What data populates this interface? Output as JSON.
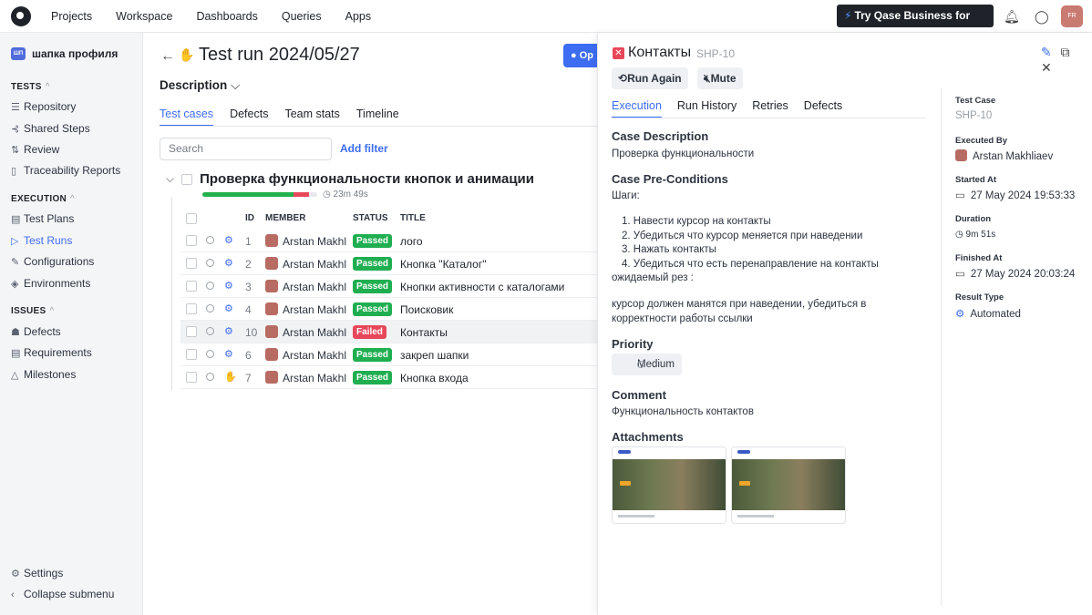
{
  "topnav": {
    "items": [
      "Projects",
      "Workspace",
      "Dashboards",
      "Queries",
      "Apps"
    ],
    "cta": "Try Qase Business for free!",
    "avatar": "FR"
  },
  "sidebar": {
    "project_badge": "ШП",
    "project": "шапка профиля",
    "tests_title": "TESTS",
    "tests": [
      "Repository",
      "Shared Steps",
      "Review",
      "Traceability Reports"
    ],
    "execution_title": "EXECUTION",
    "execution": [
      "Test Plans",
      "Test Runs",
      "Configurations",
      "Environments"
    ],
    "issues_title": "ISSUES",
    "issues": [
      "Defects",
      "Requirements",
      "Milestones"
    ],
    "settings": "Settings",
    "collapse": "Collapse submenu"
  },
  "main": {
    "title": "Test run 2024/05/27",
    "open_btn": "Op",
    "description": "Description",
    "tabs": [
      "Test cases",
      "Defects",
      "Team stats",
      "Timeline"
    ],
    "search_placeholder": "Search",
    "add_filter": "Add filter",
    "suite_title": "Проверка функциональности кнопок и анимации",
    "suite_progress": {
      "passed": 6,
      "failed": 1,
      "total": 7
    },
    "suite_duration": "23m 49s",
    "columns": [
      "ID",
      "MEMBER",
      "STATUS",
      "TITLE"
    ],
    "rows": [
      {
        "id": "1",
        "member": "Arstan Makhl",
        "status": "Passed",
        "title": "лого",
        "type": "automated"
      },
      {
        "id": "2",
        "member": "Arstan Makhl",
        "status": "Passed",
        "title": "Кнопка \"Каталог\"",
        "type": "automated"
      },
      {
        "id": "3",
        "member": "Arstan Makhl",
        "status": "Passed",
        "title": "Кнопки активности с каталогами",
        "type": "automated"
      },
      {
        "id": "4",
        "member": "Arstan Makhl",
        "status": "Passed",
        "title": "Поисковик",
        "type": "automated"
      },
      {
        "id": "10",
        "member": "Arstan Makhl",
        "status": "Failed",
        "title": "Контакты",
        "type": "automated"
      },
      {
        "id": "6",
        "member": "Arstan Makhl",
        "status": "Passed",
        "title": "закреп шапки",
        "type": "automated"
      },
      {
        "id": "7",
        "member": "Arstan Makhl",
        "status": "Passed",
        "title": "Кнопка входа",
        "type": "manual"
      }
    ]
  },
  "panel": {
    "title": "Контакты",
    "code": "SHP-10",
    "run_again": "Run Again",
    "mute": "Mute",
    "tabs": [
      "Execution",
      "Run History",
      "Retries",
      "Defects"
    ],
    "case_description_h": "Case Description",
    "case_description": "Проверка функциональности",
    "preconditions_h": "Case Pre-Conditions",
    "steps_label": "Шаги:",
    "steps": [
      "1. Навести курсор на контакты",
      "2. Убедиться что курсор меняется при наведении",
      "3. Нажать контакты",
      "4. Убедиться что есть перенаправление на контакты"
    ],
    "expected_label": "ожидаемый рез :",
    "expected_1": "курсор должен манятся при наведении, убедиться в",
    "expected_2": "корректности работы ссылки",
    "priority_h": "Priority",
    "priority": "Medium",
    "comment_h": "Comment",
    "comment": "Функциональность контактов",
    "attachments_h": "Attachments",
    "meta": {
      "test_case_l": "Test Case",
      "test_case": "SHP-10",
      "executed_by_l": "Executed By",
      "executed_by": "Arstan Makhliaev",
      "started_l": "Started At",
      "started": "27 May 2024 19:53:33",
      "duration_l": "Duration",
      "duration": "9m 51s",
      "finished_l": "Finished At",
      "finished": "27 May 2024 20:03:24",
      "result_type_l": "Result Type",
      "result_type": "Automated"
    }
  },
  "colors": {
    "accent": "#3d6df2",
    "passed": "#1fae50",
    "failed": "#e8475a"
  }
}
